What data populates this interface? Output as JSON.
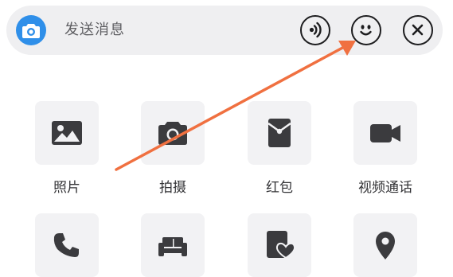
{
  "input_bar": {
    "placeholder": "发送消息",
    "left_icon": "camera-icon",
    "right_icons": [
      "voice-icon",
      "emoji-icon",
      "close-icon"
    ],
    "accent_color": "#2f8fe9"
  },
  "panel": {
    "items": [
      {
        "label": "照片",
        "icon": "photo-icon"
      },
      {
        "label": "拍摄",
        "icon": "camera-icon"
      },
      {
        "label": "红包",
        "icon": "red-packet-icon"
      },
      {
        "label": "视频通话",
        "icon": "video-call-icon"
      },
      {
        "label": "",
        "icon": "phone-icon"
      },
      {
        "label": "",
        "icon": "sofa-icon"
      },
      {
        "label": "",
        "icon": "favorite-card-icon"
      },
      {
        "label": "",
        "icon": "location-icon"
      }
    ]
  },
  "annotation": {
    "type": "arrow",
    "color": "#f07040",
    "points_to": "emoji-icon"
  }
}
